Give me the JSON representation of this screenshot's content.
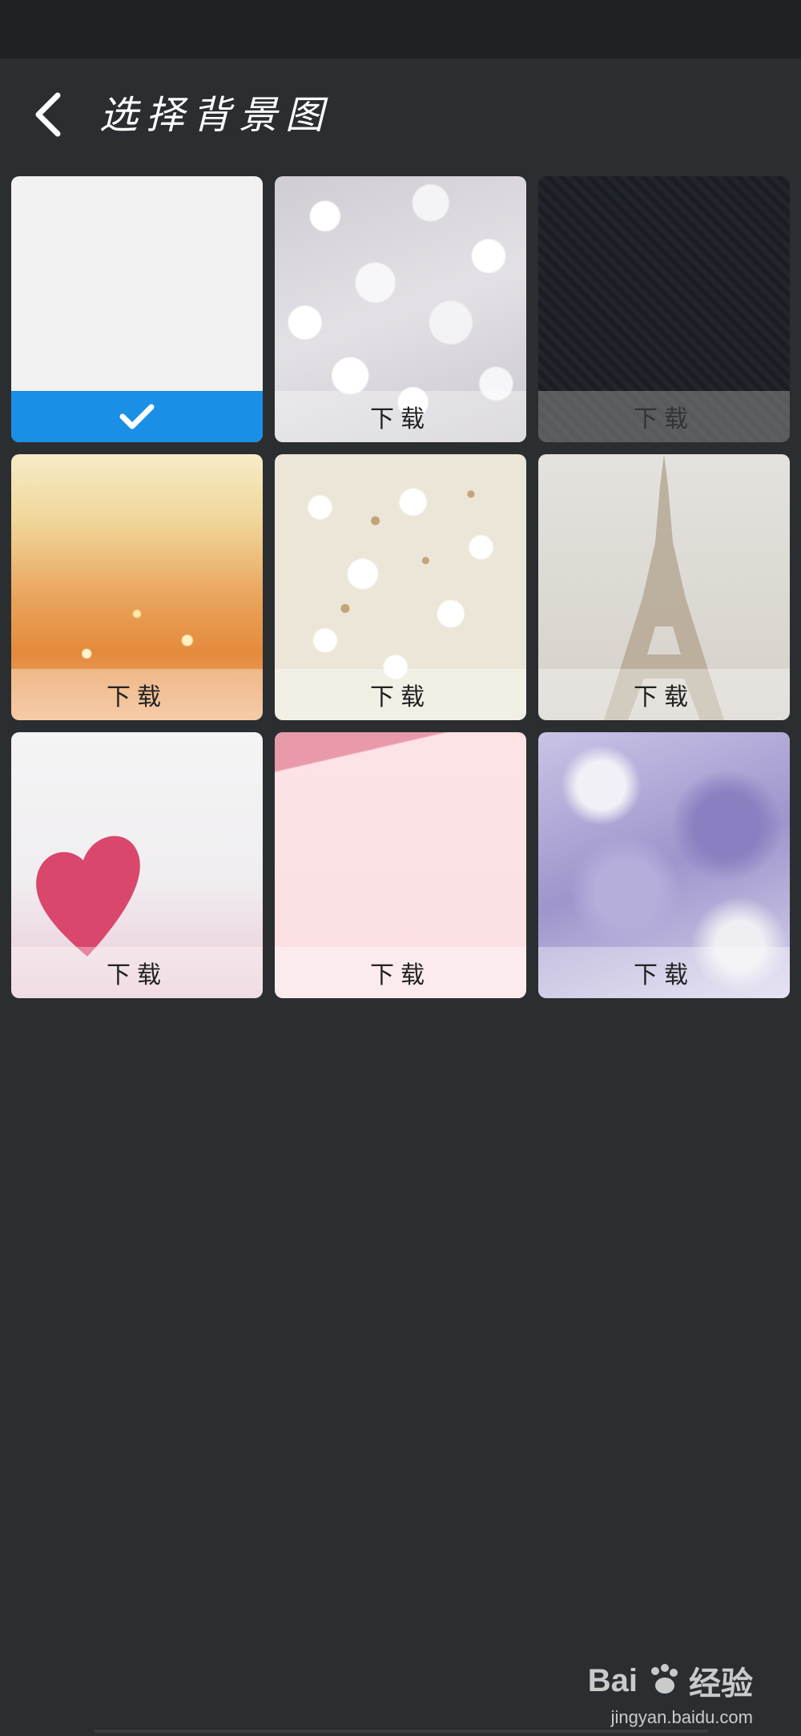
{
  "header": {
    "title": "选择背景图",
    "back_icon": "chevron-left-icon"
  },
  "tiles": [
    {
      "label": "",
      "selected": true,
      "icon": "check-icon",
      "accent": "#1a8fe6"
    },
    {
      "label": "下载",
      "selected": false
    },
    {
      "label": "下载",
      "selected": false
    },
    {
      "label": "下载",
      "selected": false
    },
    {
      "label": "下载",
      "selected": false
    },
    {
      "label": "下载",
      "selected": false
    },
    {
      "label": "下载",
      "selected": false
    },
    {
      "label": "下载",
      "selected": false
    },
    {
      "label": "下载",
      "selected": false
    }
  ],
  "watermark": {
    "brand": "Bai",
    "brand_suffix": "经验",
    "url": "jingyan.baidu.com"
  },
  "colors": {
    "background": "#2b2e30",
    "status_bar": "#1f2224",
    "selected": "#1a8fe6"
  }
}
